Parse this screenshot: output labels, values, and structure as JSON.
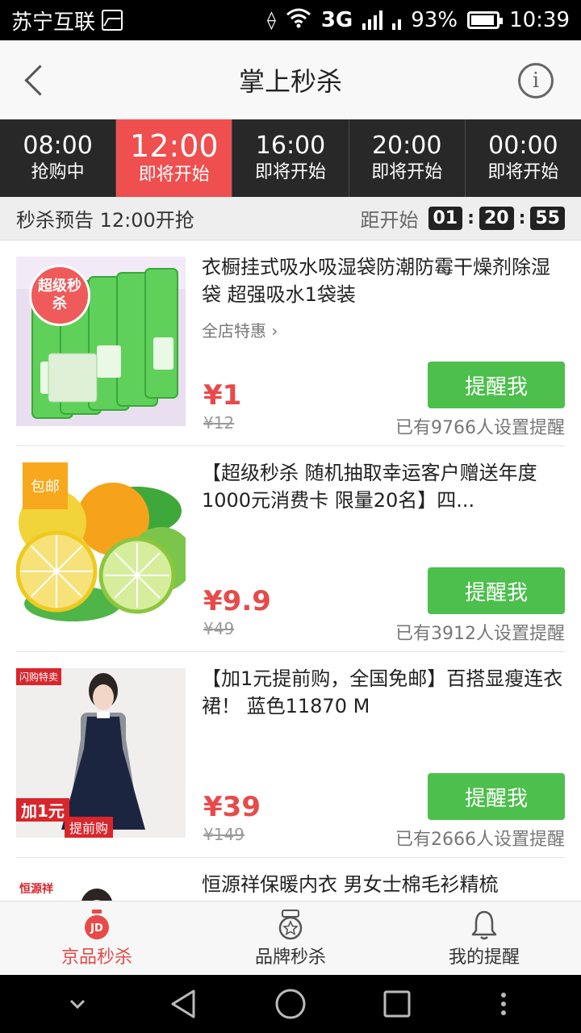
{
  "status_bar": {
    "carrier": "苏宁互联",
    "network": "3G",
    "battery": "93%",
    "time": "10:39"
  },
  "header": {
    "title": "掌上秒杀",
    "info_icon": "i"
  },
  "time_tabs": [
    {
      "time": "08:00",
      "status": "抢购中",
      "active": false
    },
    {
      "time": "12:00",
      "status": "即将开始",
      "active": true
    },
    {
      "time": "16:00",
      "status": "即将开始",
      "active": false
    },
    {
      "time": "20:00",
      "status": "即将开始",
      "active": false
    },
    {
      "time": "00:00",
      "status": "即将开始",
      "active": false
    }
  ],
  "preview": {
    "label": "秒杀预告 12:00开抢",
    "countdown_label": "距开始",
    "hours": "01",
    "minutes": "20",
    "seconds": "55"
  },
  "products": [
    {
      "title": "衣橱挂式吸水吸湿袋防潮防霉干燥剂除湿袋 超强吸水1袋装",
      "shop_link": "全店特惠",
      "price": "¥1",
      "old_price": "¥12",
      "button": "提醒我",
      "remind_count": "已有9766人设置提醒",
      "badge": "超级秒杀"
    },
    {
      "title": "【超级秒杀 随机抽取幸运客户赠送年度1000元消费卡 限量20名】四...",
      "price": "¥9.9",
      "old_price": "¥49",
      "button": "提醒我",
      "remind_count": "已有3912人设置提醒",
      "badge": "包邮"
    },
    {
      "title": "【加1元提前购，全国免邮】百搭显瘦连衣裙！ 蓝色11870 M",
      "price": "¥39",
      "old_price": "¥149",
      "button": "提醒我",
      "remind_count": "已有2666人设置提醒",
      "badge_top": "闪购特卖",
      "badge_bottom": "加1元",
      "badge_sub": "提前购"
    },
    {
      "title": "恒源祥保暖内衣 男女士棉毛衫精梳",
      "badge": "恒源祥"
    }
  ],
  "bottom_nav": [
    {
      "label": "京品秒杀",
      "icon": "jd-stopwatch-icon",
      "active": true
    },
    {
      "label": "品牌秒杀",
      "icon": "medal-icon",
      "active": false
    },
    {
      "label": "我的提醒",
      "icon": "bell-icon",
      "active": false
    }
  ],
  "colors": {
    "accent_red": "#ef4f4f",
    "price_red": "#e84a4a",
    "button_green": "#4cbf4c",
    "tab_dark": "#282828"
  }
}
